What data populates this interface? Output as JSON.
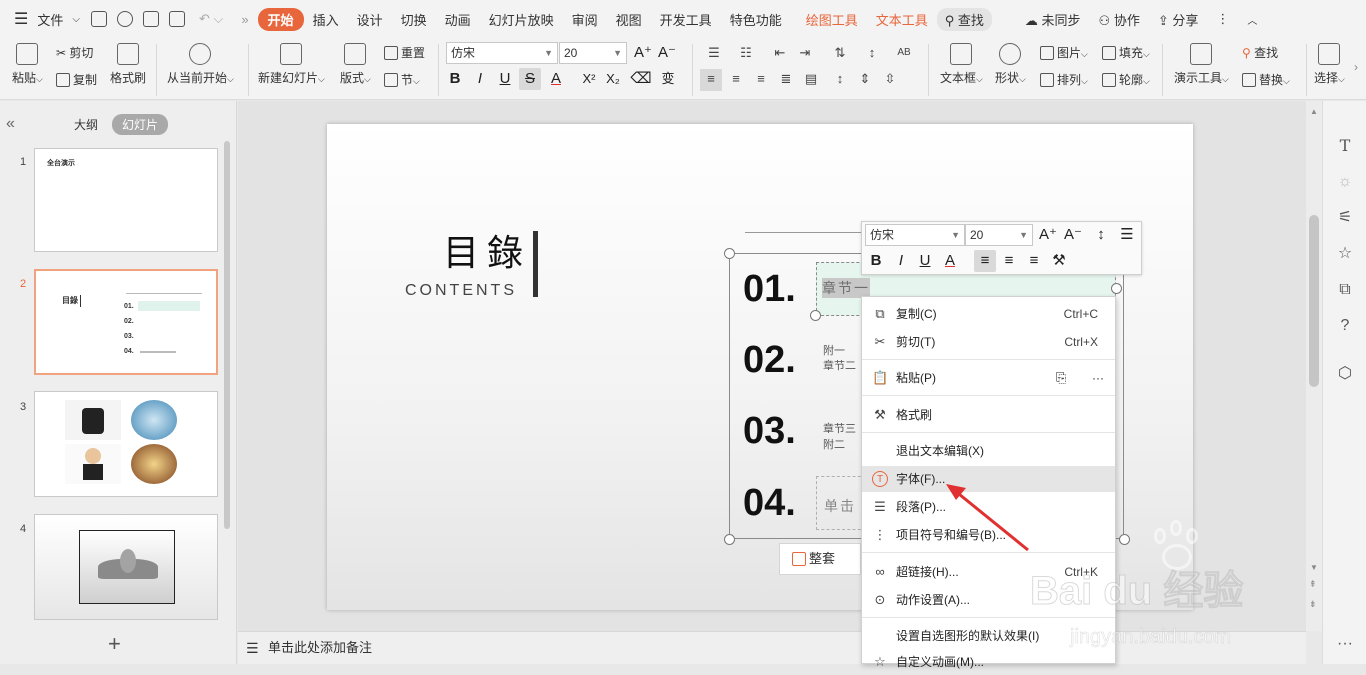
{
  "menubar": {
    "file": "文件",
    "tabs": [
      "开始",
      "插入",
      "设计",
      "切换",
      "动画",
      "幻灯片放映",
      "审阅",
      "视图",
      "开发工具",
      "特色功能",
      "绘图工具",
      "文本工具"
    ],
    "search": "查找",
    "sync": "未同步",
    "collab": "协作",
    "share": "分享"
  },
  "ribbon": {
    "paste": "粘贴",
    "cut": "剪切",
    "copy": "复制",
    "format_painter": "格式刷",
    "play_from_current": "从当前开始",
    "new_slide": "新建幻灯片",
    "layout": "版式",
    "reset": "重置",
    "section": "节",
    "font_name": "仿宋",
    "font_size": "20",
    "textbox": "文本框",
    "shape": "形状",
    "picture": "图片",
    "fill": "填充",
    "arrange": "排列",
    "outline": "轮廓",
    "present_tools": "演示工具",
    "find": "查找",
    "replace": "替换",
    "select": "选择"
  },
  "leftpanel": {
    "outline_tab": "大纲",
    "slides_tab": "幻灯片",
    "slides": [
      {
        "num": "1",
        "title": "全台演示"
      },
      {
        "num": "2"
      },
      {
        "num": "3"
      },
      {
        "num": "4"
      }
    ],
    "add": "+"
  },
  "slide": {
    "title": "目錄",
    "subtitle": "CONTENTS",
    "items": [
      {
        "num": "01.",
        "text": "章节一"
      },
      {
        "num": "02.",
        "line1": "附一",
        "line2": "章节二"
      },
      {
        "num": "03.",
        "line1": "章节三",
        "line2": "附二"
      },
      {
        "num": "04.",
        "text": "单击"
      }
    ],
    "arrange_btn": "整套"
  },
  "notes": {
    "placeholder": "单击此处添加备注"
  },
  "minitoolbar": {
    "font": "仿宋",
    "size": "20"
  },
  "context_menu": {
    "items": [
      {
        "label": "复制(C)",
        "shortcut": "Ctrl+C"
      },
      {
        "label": "剪切(T)",
        "shortcut": "Ctrl+X"
      },
      {
        "label": "粘贴(P)"
      },
      {
        "label": "格式刷"
      },
      {
        "label": "退出文本编辑(X)"
      },
      {
        "label": "字体(F)..."
      },
      {
        "label": "段落(P)..."
      },
      {
        "label": "项目符号和编号(B)..."
      },
      {
        "label": "超链接(H)...",
        "shortcut": "Ctrl+K"
      },
      {
        "label": "动作设置(A)..."
      },
      {
        "label": "设置自选图形的默认效果(I)"
      },
      {
        "label": "自定义动画(M)..."
      }
    ]
  },
  "watermark": {
    "brand": "Bai du 经验",
    "url": "jingyan.baidu.com"
  },
  "colors": {
    "accent": "#e8663b",
    "arrow": "#e03030"
  }
}
